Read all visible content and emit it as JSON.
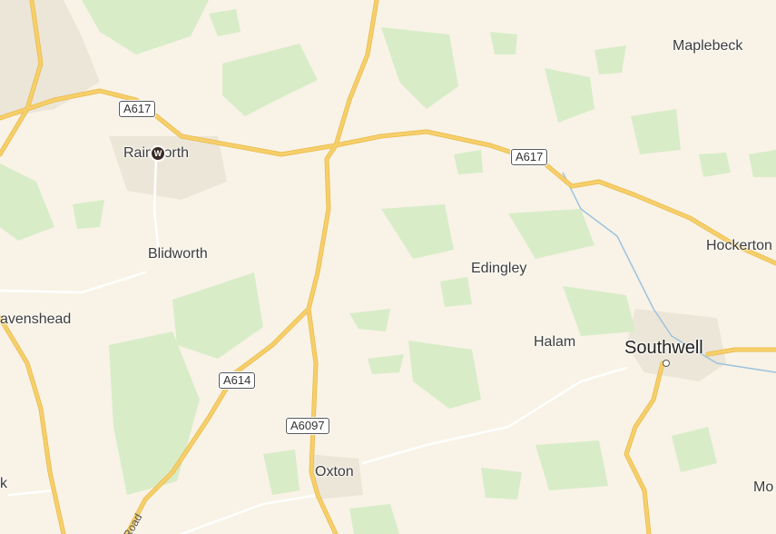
{
  "map": {
    "places": [
      {
        "id": "maplebeck",
        "name": "Maplebeck"
      },
      {
        "id": "rainworth",
        "name": "Rainworth"
      },
      {
        "id": "blidworth",
        "name": "Blidworth"
      },
      {
        "id": "edingley",
        "name": "Edingley"
      },
      {
        "id": "hockerton",
        "name": "Hockerton"
      },
      {
        "id": "ravenshead",
        "name": "avenshead"
      },
      {
        "id": "halam",
        "name": "Halam"
      },
      {
        "id": "southwell",
        "name": "Southwell"
      },
      {
        "id": "oxton",
        "name": "Oxton"
      },
      {
        "id": "left-edge",
        "name": "k"
      },
      {
        "id": "right-edge",
        "name": "Mo"
      }
    ],
    "roads": [
      {
        "id": "a617-west",
        "ref": "A617"
      },
      {
        "id": "a617-east",
        "ref": "A617"
      },
      {
        "id": "a614",
        "ref": "A614"
      },
      {
        "id": "a6097",
        "ref": "A6097"
      }
    ],
    "road_names": [
      {
        "id": "road-label",
        "name": "Road"
      }
    ],
    "marker": {
      "glyph": "W",
      "color": "#3a2a26"
    },
    "colors": {
      "land": "#f8f3e6",
      "woodland": "#d8ecc8",
      "urban": "#ece6d8",
      "major_road": "#f6cf6a",
      "minor_road": "#ffffff",
      "water": "#9cc3de"
    }
  }
}
